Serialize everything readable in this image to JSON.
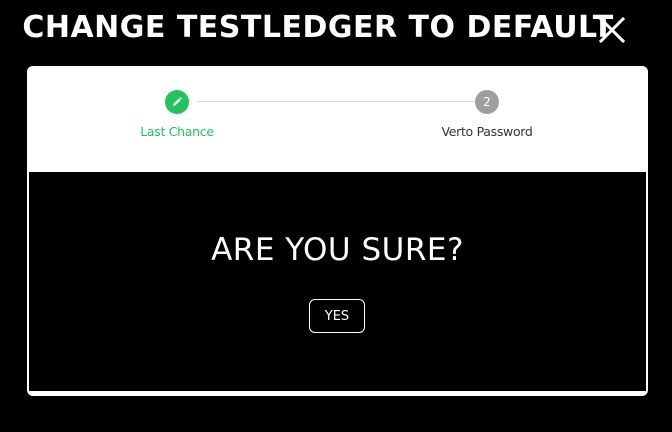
{
  "header": {
    "title": "CHANGE TESTLEDGER TO DEFAULT",
    "close_icon": "close-icon"
  },
  "stepper": {
    "steps": [
      {
        "label": "Last Chance",
        "icon": "pencil-icon",
        "status": "active",
        "color": "#21c45a"
      },
      {
        "label": "Verto Password",
        "number": "2",
        "status": "pending",
        "color": "#9e9e9e"
      }
    ]
  },
  "content": {
    "question": "ARE YOU SURE?",
    "yes_label": "YES"
  },
  "colors": {
    "background": "#000000",
    "modal": "#ffffff",
    "accent": "#21c45a",
    "inactive": "#9e9e9e"
  }
}
